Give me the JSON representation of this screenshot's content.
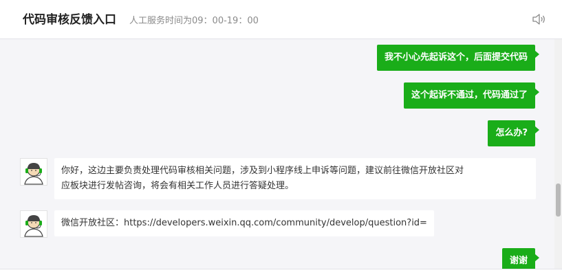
{
  "header": {
    "title": "代码审核反馈入口",
    "service_hours": "人工服务时间为09：00-19：00",
    "speaker_icon": "speaker-icon"
  },
  "messages": [
    {
      "from": "user",
      "text": "我不小心先起诉这个，后面提交代码"
    },
    {
      "from": "user",
      "text": "这个起诉不通过，代码通过了"
    },
    {
      "from": "user",
      "text": "怎么办?"
    },
    {
      "from": "agent",
      "avatar_icon": "support-agent-avatar",
      "lines": [
        "你好，这边主要负责处理代码审核相关问题，涉及到小程序线上申诉等问题，建议前往微信开放社区对",
        "应板块进行发帖咨询，将会有相关工作人员进行答疑处理。"
      ]
    },
    {
      "from": "agent",
      "avatar_icon": "support-agent-avatar",
      "lines": [
        "微信开放社区：https://developers.weixin.qq.com/community/develop/question?id="
      ]
    },
    {
      "from": "user",
      "text": "谢谢"
    }
  ],
  "colors": {
    "user_bubble": "#1aad19",
    "chat_background": "#f5f5f8",
    "agent_bubble": "#ffffff"
  }
}
